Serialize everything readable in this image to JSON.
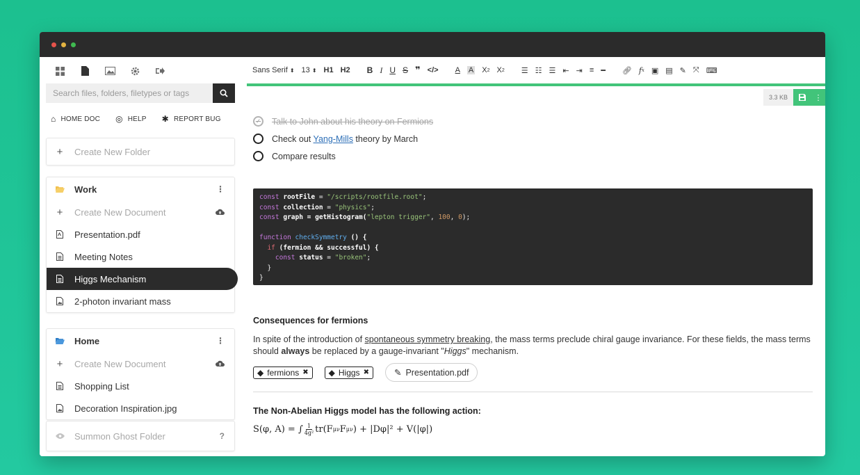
{
  "sidebar": {
    "search": {
      "placeholder": "Search files, folders, filetypes or tags"
    },
    "quicklinks": [
      "HOME DOC",
      "HELP",
      "REPORT BUG"
    ],
    "create_folder": "Create New Folder",
    "folders": [
      {
        "name": "Work",
        "create_doc": "Create New Document",
        "items": [
          "Presentation.pdf",
          "Meeting Notes",
          "Higgs Mechanism",
          "2-photon invariant mass"
        ]
      },
      {
        "name": "Home",
        "create_doc": "Create New Document",
        "items": [
          "Shopping List",
          "Decoration Inspiration.jpg"
        ]
      }
    ],
    "ghost_folder": "Summon Ghost Folder",
    "ghost_help": "?"
  },
  "toolbar": {
    "font": "Sans Serif",
    "size": "13",
    "h1": "H1",
    "h2": "H2",
    "bold": "B",
    "italic": "I",
    "underline": "U",
    "strike": "S"
  },
  "status": {
    "filesize": "3.3 KB"
  },
  "tasks": [
    {
      "text": "Talk to John about his theory on Fermions",
      "done": true
    },
    {
      "prefix": "Check out ",
      "link": "Yang-Mills",
      "suffix": " theory by March",
      "done": false
    },
    {
      "text": "Compare results",
      "done": false
    }
  ],
  "code": {
    "line1": {
      "kw": "const",
      "var": "rootFile",
      "op": " = ",
      "str": "\"/scripts/rootfile.root\"",
      "end": ";"
    },
    "line2": {
      "kw": "const",
      "var": "collection",
      "op": " = ",
      "str": "\"physics\"",
      "end": ";"
    },
    "line3": {
      "kw": "const",
      "var": "graph",
      "op": " = getHistogram(",
      "str": "\"lepton trigger\"",
      "sep": ", ",
      "n1": "100",
      "n2": "0",
      "end": ");"
    },
    "line5": {
      "kw": "function",
      "fn": "checkSymmetry",
      "end": " () {"
    },
    "line6": {
      "kw": "if",
      "cond": " (fermion && successful) {"
    },
    "line7": {
      "kw": "const",
      "var": "status",
      "op": " = ",
      "str": "\"broken\"",
      "end": ";"
    },
    "line8": "}",
    "line9": "}"
  },
  "section1": {
    "heading": "Consequences for fermions",
    "p1": "In spite of the introduction of ",
    "p_link": "spontaneous symmetry breaking",
    "p2": ", the mass terms preclude chiral gauge invariance. For these fields, the mass terms should ",
    "p_bold": "always",
    "p3": " be replaced by a gauge-invariant \"",
    "p_italic": "Higgs",
    "p4": "\" mechanism."
  },
  "tags": [
    "fermions",
    "Higgs"
  ],
  "attachment": "Presentation.pdf",
  "section2": {
    "heading": "The Non-Abelian Higgs model has the following action:",
    "formula_left": "S(φ, A) = ∫",
    "frac_num": "1",
    "frac_den": "4g²",
    "formula_right": "tr(F",
    "sup": "μν",
    "mid": "F",
    "sub": "μν",
    "tail": ") + |Dφ|² + V(|φ|)"
  },
  "colors": {
    "accent": "#42c47a",
    "dark": "#2b2b2b",
    "background": "#1cc08f"
  }
}
